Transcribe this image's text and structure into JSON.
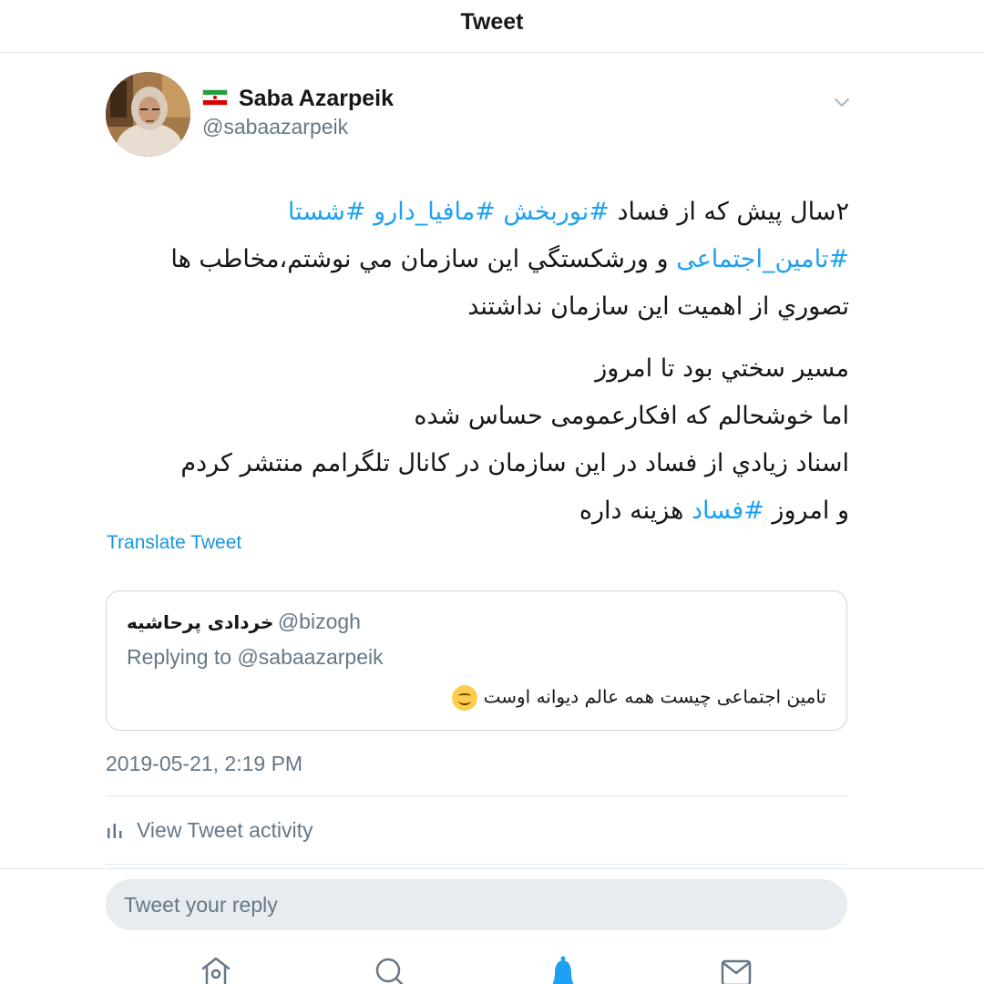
{
  "header": {
    "title": "Tweet"
  },
  "author": {
    "display_name": "Saba Azarpeik",
    "handle": "@sabaazarpeik",
    "flag_icon": "iran-flag-icon"
  },
  "tweet": {
    "line1_start": "۲سال پیش که از فساد ",
    "line1_tags": "#نوربخش #مافیا_دارو #شستا",
    "line2_tag": "#تامین_اجتماعی",
    "line2_rest": " و ورشکستگي اين سازمان مي نوشتم،مخاطب ها",
    "line3": "تصوري از اهميت اين سازمان نداشتند",
    "line4": "مسير سختي بود تا امروز",
    "line5": "اما خوشحالم که افکارعمومی حساس شده",
    "line6": "اسناد زيادي از فساد در اين سازمان در کانال تلگرامم منتشر کردم",
    "line7_start": "و امروز ",
    "line7_tag": "#فساد",
    "line7_end": " هزينه داره",
    "translate_label": "Translate Tweet",
    "timestamp": "2019-05-21, 2:19 PM",
    "activity_label": "View Tweet activity"
  },
  "quoted": {
    "name": "خردادی پرحاشیه",
    "handle": "@bizogh",
    "replying_to": "Replying to @sabaazarpeik",
    "text": "تامین اجتماعی چیست همه عالم دیوانه اوست",
    "emoji": "smiling-face-icon"
  },
  "reply": {
    "placeholder": "Tweet your reply"
  },
  "colors": {
    "accent": "#1da1f2",
    "secondary_text": "#657786",
    "border": "#e1e8ed"
  },
  "nav": {
    "active": "notifications",
    "items": [
      "home-icon",
      "search-icon",
      "notifications-icon",
      "messages-icon"
    ]
  }
}
